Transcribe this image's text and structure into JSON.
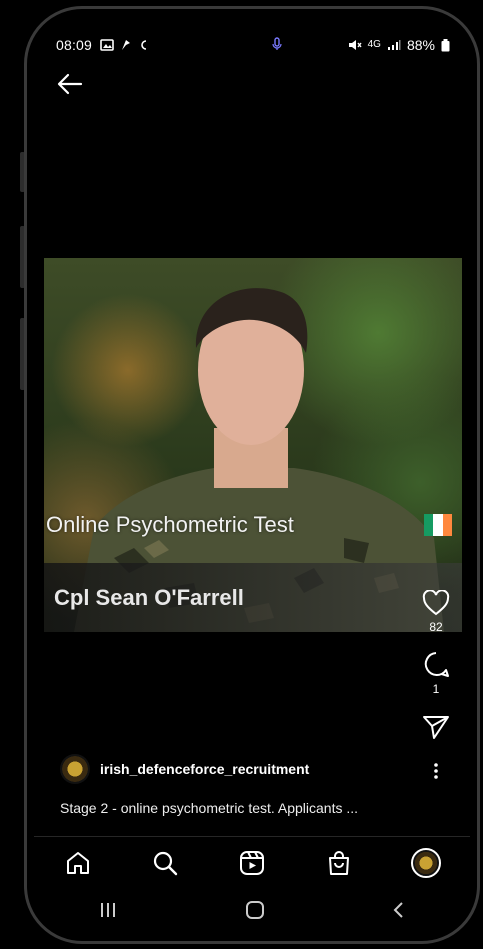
{
  "status_bar": {
    "time": "08:09",
    "battery": "88%",
    "network": "4G"
  },
  "video": {
    "caption": "Online Psychometric Test",
    "speaker_name": "Cpl Sean O'Farrell"
  },
  "actions": {
    "likes": "82",
    "comments": "1"
  },
  "post": {
    "account": "irish_defenceforce_recruitment",
    "description": "Stage 2 - online psychometric test. Applicants ..."
  },
  "colors": {
    "background": "#000000",
    "text": "#ffffff"
  }
}
